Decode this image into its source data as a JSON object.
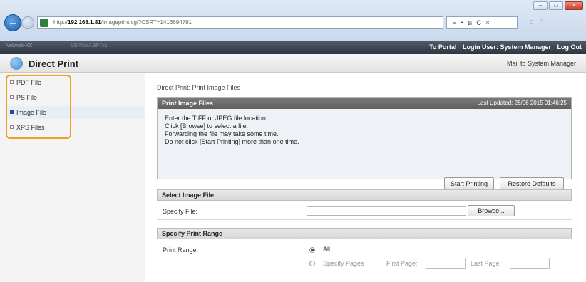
{
  "browser": {
    "url_prefix": "http://",
    "url_host": "192.168.1.81",
    "url_path": "/imageprint.cgi?CSRT=1416694791",
    "address_tools": "⌕ • ⊠ C ×",
    "window_buttons": [
      "–",
      "□",
      "×"
    ]
  },
  "topbar": {
    "device_name": "Network-XX",
    "device_model": "LBP7xx/LBP7xx",
    "to_portal": "To Portal",
    "login_user": "Login User: System Manager",
    "logout": "Log Out"
  },
  "header": {
    "title": "Direct Print",
    "mail_link": "Mail to System Manager"
  },
  "sidebar": {
    "items": [
      {
        "label": "PDF File",
        "active": false
      },
      {
        "label": "PS File",
        "active": false
      },
      {
        "label": "Image File",
        "active": true
      },
      {
        "label": "XPS Files",
        "active": false
      }
    ]
  },
  "main": {
    "breadcrumb": "Direct Print: Print Image Files",
    "panel_title": "Print Image Files",
    "last_updated": "Last Updated: 26/06 2015 01:46:25",
    "instructions": [
      "Enter the TIFF or JPEG file location.",
      "Click [Browse] to select a file.",
      "Forwarding the file may take some time.",
      "Do not click [Start Printing] more than one time."
    ],
    "start_button": "Start Printing",
    "restore_button": "Restore Defaults",
    "select_section": "Select Image File",
    "specify_file_label": "Specify File:",
    "browse_button": "Browse...",
    "range_section": "Specify Print Range",
    "print_range_label": "Print Range:",
    "option_all": "All",
    "option_pages": "Specify Pages",
    "first_page_label": "First Page:",
    "last_page_label": "Last Page:"
  }
}
